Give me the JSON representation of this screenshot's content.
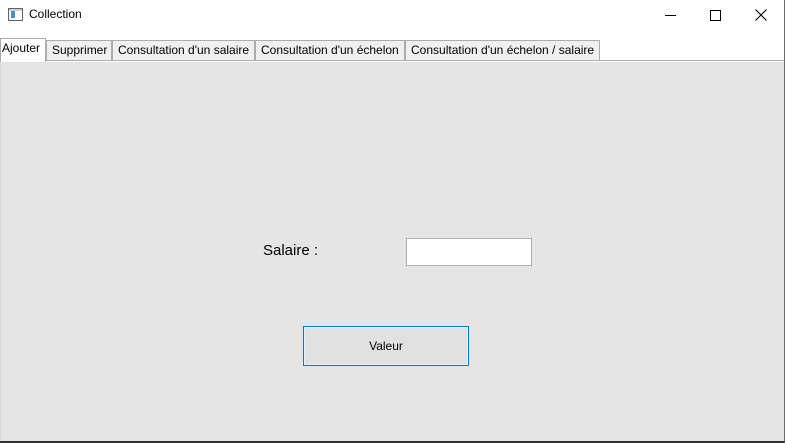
{
  "window": {
    "title": "Collection",
    "icon": "app-window-icon",
    "controls": {
      "minimize": "minimize-icon",
      "maximize": "maximize-icon",
      "close": "close-icon"
    }
  },
  "tabs": [
    {
      "label": "Ajouter",
      "active": true
    },
    {
      "label": "Supprimer",
      "active": false
    },
    {
      "label": "Consultation d'un salaire",
      "active": false
    },
    {
      "label": "Consultation d'un échelon",
      "active": false
    },
    {
      "label": "Consultation d'un échelon / salaire",
      "active": false
    }
  ],
  "form": {
    "salaire_label": "Salaire :",
    "salaire_value": "",
    "submit_label": "Valeur"
  },
  "colors": {
    "content_bg": "#e5e5e5",
    "button_border": "#0078d7",
    "tab_border": "#acacac"
  }
}
